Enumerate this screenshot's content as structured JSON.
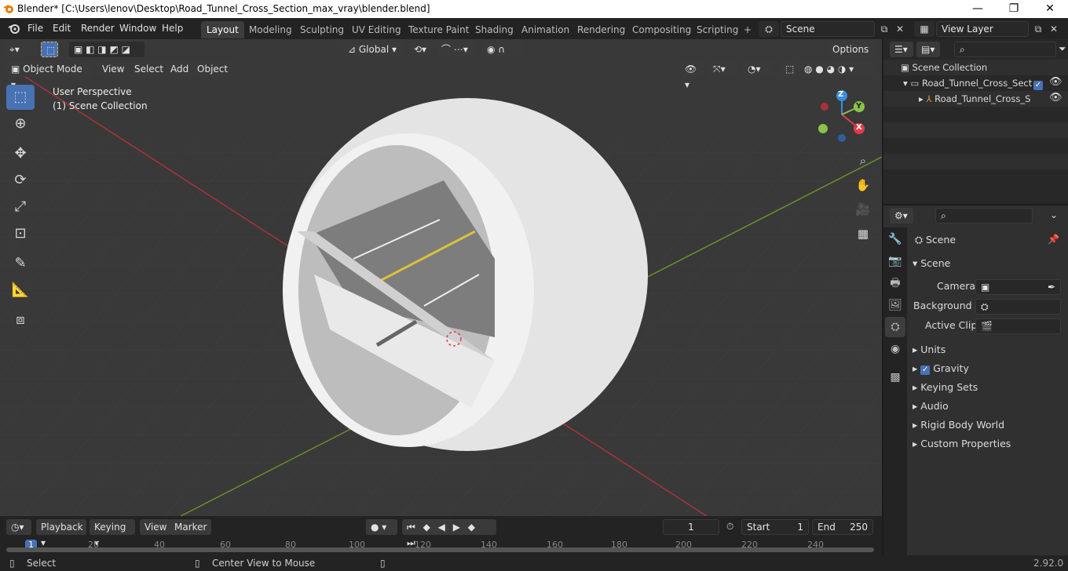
{
  "titlebar": {
    "title": "Blender* [C:\\Users\\lenov\\Desktop\\Road_Tunnel_Cross_Section_max_vray\\blender.blend]",
    "minimize": "—",
    "maximize": "❐",
    "close": "✕"
  },
  "menu": {
    "file": "File",
    "edit": "Edit",
    "render": "Render",
    "window": "Window",
    "help": "Help"
  },
  "workspaces": [
    "Layout",
    "Modeling",
    "Sculpting",
    "UV Editing",
    "Texture Paint",
    "Shading",
    "Animation",
    "Rendering",
    "Compositing",
    "Scripting"
  ],
  "workspace_add": "+",
  "scene": {
    "name": "Scene"
  },
  "view_layer": {
    "name": "View Layer"
  },
  "viewport": {
    "transform_orientation": "Global",
    "options_label": "Options",
    "mode": "Object Mode",
    "menu_view": "View",
    "menu_select": "Select",
    "menu_add": "Add",
    "menu_object": "Object",
    "overlay_perspective": "User Perspective",
    "overlay_collection": "(1) Scene Collection",
    "gizmo": {
      "x": "X",
      "y": "Y",
      "z": "Z"
    }
  },
  "outliner": {
    "root": "Scene Collection",
    "collection": "Road_Tunnel_Cross_Sect",
    "object": "Road_Tunnel_Cross_S"
  },
  "properties": {
    "header": "Scene",
    "panel_scene": "Scene",
    "camera_label": "Camera",
    "background_label": "Background ...",
    "active_clip_label": "Active Clip",
    "panels": [
      "Units",
      "Gravity",
      "Keying Sets",
      "Audio",
      "Rigid Body World",
      "Custom Properties"
    ]
  },
  "timeline": {
    "playback": "Playback",
    "keying": "Keying",
    "view": "View",
    "marker": "Marker",
    "current_frame": "1",
    "start_label": "Start",
    "start": "1",
    "end_label": "End",
    "end": "250",
    "ticks": [
      "1",
      "20",
      "40",
      "60",
      "80",
      "100",
      "120",
      "140",
      "160",
      "180",
      "200",
      "220",
      "240"
    ]
  },
  "statusbar": {
    "select": "Select",
    "center": "Center View to Mouse",
    "version": "2.92.0"
  },
  "colors": {
    "accent": "#4772b3",
    "x_axis": "#e33b4a",
    "y_axis": "#8bc34a",
    "z_axis": "#3a8de0"
  }
}
